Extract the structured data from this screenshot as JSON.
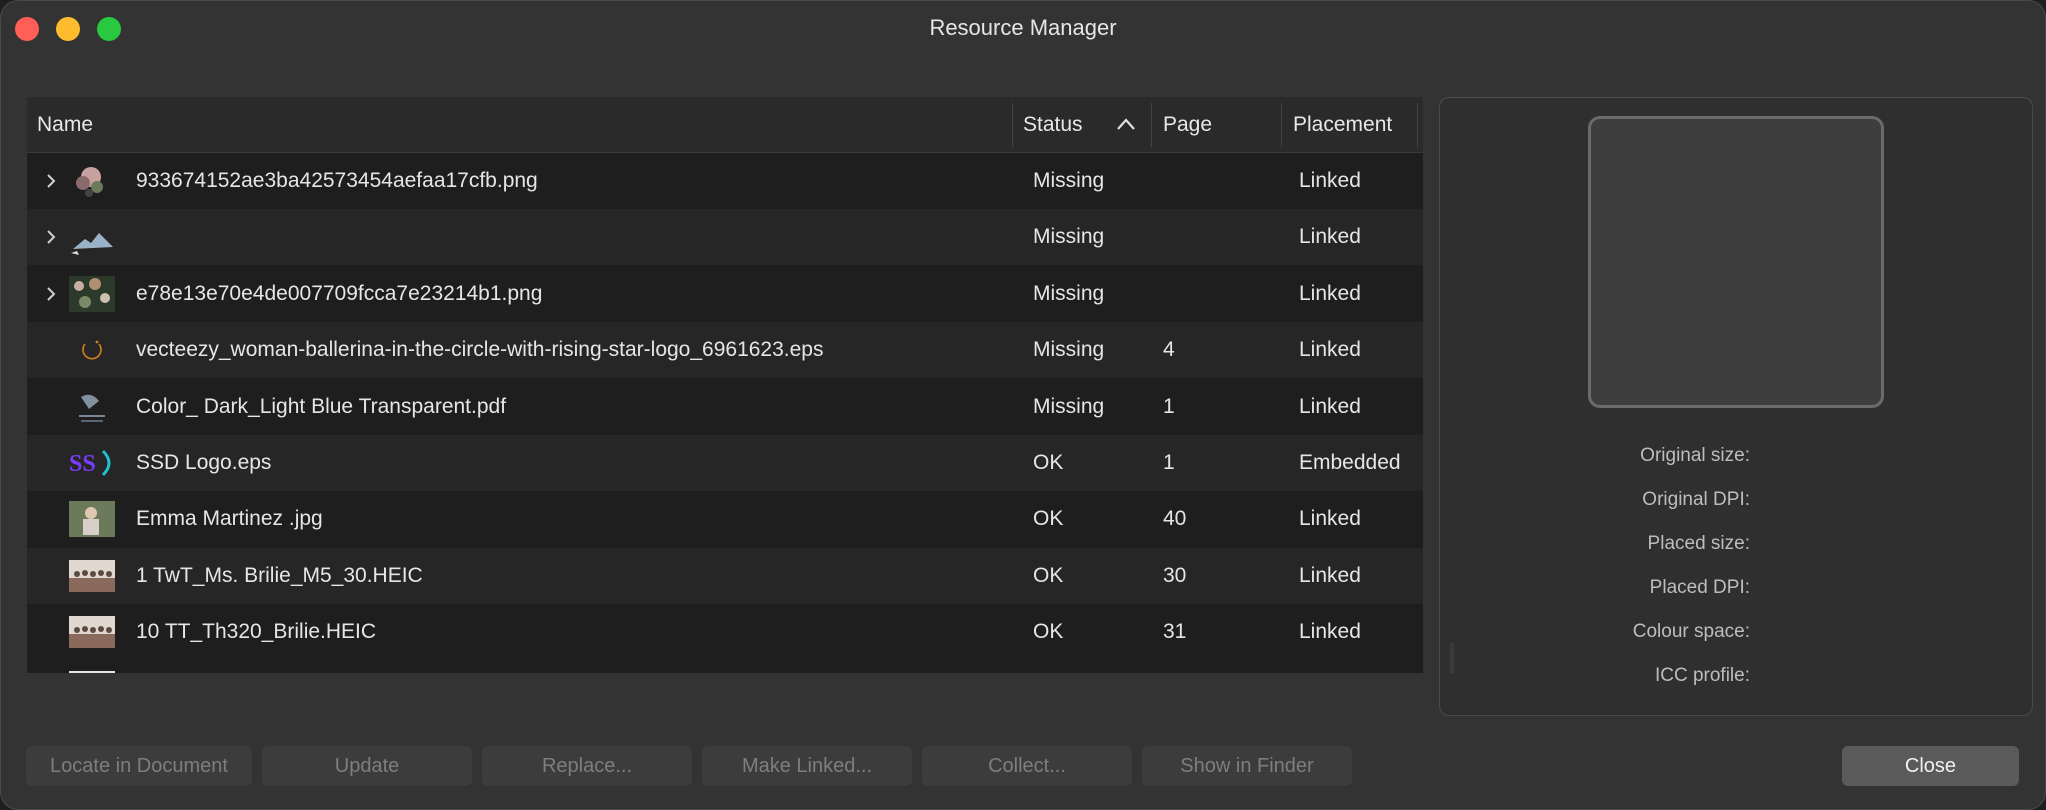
{
  "window": {
    "title": "Resource Manager"
  },
  "table": {
    "headers": {
      "name": "Name",
      "status": "Status",
      "page": "Page",
      "placement": "Placement"
    },
    "rows": [
      {
        "name": "933674152ae3ba42573454aefaa17cfb.png",
        "status": "Missing",
        "page": "",
        "placement": "Linked",
        "expandable": true,
        "thumb": "flower-thumb"
      },
      {
        "name": "",
        "status": "Missing",
        "page": "",
        "placement": "Linked",
        "expandable": true,
        "thumb": "mountain-thumb"
      },
      {
        "name": "e78e13e70e4de007709fcca7e23214b1.png",
        "status": "Missing",
        "page": "",
        "placement": "Linked",
        "expandable": true,
        "thumb": "floral-thumb"
      },
      {
        "name": "vecteezy_woman-ballerina-in-the-circle-with-rising-star-logo_6961623.eps",
        "status": "Missing",
        "page": "4",
        "placement": "Linked",
        "expandable": false,
        "thumb": "ballerina-logo-thumb"
      },
      {
        "name": "Color_ Dark_Light Blue Transparent.pdf",
        "status": "Missing",
        "page": "1",
        "placement": "Linked",
        "expandable": false,
        "thumb": "dark-logo-thumb"
      },
      {
        "name": "SSD Logo.eps",
        "status": "OK",
        "page": "1",
        "placement": "Embedded",
        "expandable": false,
        "thumb": "ssd-logo-thumb"
      },
      {
        "name": "Emma Martinez .jpg",
        "status": "OK",
        "page": "40",
        "placement": "Linked",
        "expandable": false,
        "thumb": "photo-thumb"
      },
      {
        "name": "1 TwT_Ms. Brilie_M5_30.HEIC",
        "status": "OK",
        "page": "30",
        "placement": "Linked",
        "expandable": false,
        "thumb": "group-photo-thumb"
      },
      {
        "name": "10 TT_Th320_Brilie.HEIC",
        "status": "OK",
        "page": "31",
        "placement": "Linked",
        "expandable": false,
        "thumb": "group-photo-thumb"
      }
    ]
  },
  "panel": {
    "labels": [
      "Original size:",
      "Original DPI:",
      "Placed size:",
      "Placed DPI:",
      "Colour space:",
      "ICC profile:"
    ]
  },
  "buttons": {
    "locate": "Locate in Document",
    "update": "Update",
    "replace": "Replace...",
    "make_linked": "Make Linked...",
    "collect": "Collect...",
    "show_in_finder": "Show in Finder",
    "close": "Close"
  },
  "colors": {
    "window_bg": "#333333",
    "table_bg": "#1e1e1e",
    "row_alt": "#262626",
    "text": "#e6e6e6"
  }
}
